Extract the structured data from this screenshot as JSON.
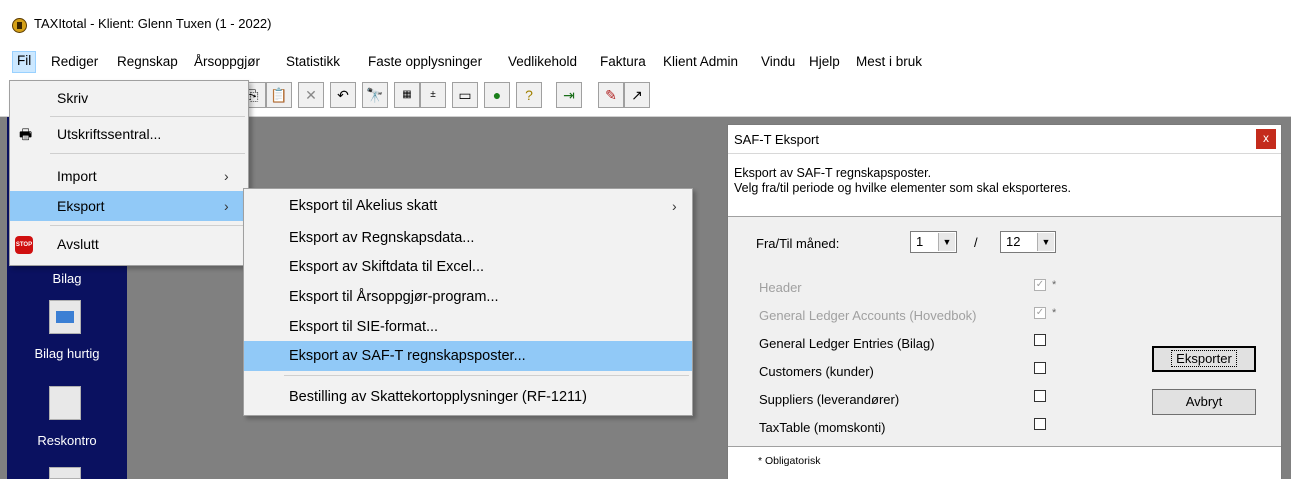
{
  "window": {
    "title": "TAXItotal - Klient: Glenn Tuxen (1 - 2022)"
  },
  "menubar": {
    "items": [
      "Fil",
      "Rediger",
      "Regnskap",
      "Årsoppgjør",
      "Statistikk",
      "Faste opplysninger",
      "Vedlikehold",
      "Faktura",
      "Klient Admin",
      "Vindu",
      "Hjelp",
      "Mest i bruk"
    ]
  },
  "fil_menu": {
    "skriv": "Skriv",
    "utskriftssentral": "Utskriftssentral...",
    "import": "Import",
    "eksport": "Eksport",
    "avslutt": "Avslutt",
    "stop_badge": "STOP"
  },
  "export_menu": {
    "items": [
      "Eksport til Akelius skatt",
      "Eksport av Regnskapsdata...",
      "Eksport av Skiftdata til Excel...",
      "Eksport til Årsoppgjør-program...",
      "Eksport til SIE-format...",
      "Eksport av SAF-T regnskapsposter...",
      "Bestilling av Skattekortopplysninger (RF-1211)"
    ],
    "highlighted_index": 5
  },
  "sidebar": {
    "items": [
      "Bilag",
      "Bilag hurtig",
      "Reskontro"
    ]
  },
  "dialog": {
    "title": "SAF-T Eksport",
    "close": "x",
    "desc_line1": "Eksport av SAF-T regnskapsposter.",
    "desc_line2": "Velg fra/til periode og hvilke elementer som skal eksporteres.",
    "period_label": "Fra/Til måned:",
    "from_month": "1",
    "separator": "/",
    "to_month": "12",
    "elements": [
      {
        "label": "Header",
        "checked": true,
        "disabled": true,
        "required": "*"
      },
      {
        "label": "General Ledger Accounts (Hovedbok)",
        "checked": true,
        "disabled": true,
        "required": "*"
      },
      {
        "label": "General Ledger Entries (Bilag)",
        "checked": false,
        "disabled": false,
        "required": ""
      },
      {
        "label": "Customers (kunder)",
        "checked": false,
        "disabled": false,
        "required": ""
      },
      {
        "label": "Suppliers (leverandører)",
        "checked": false,
        "disabled": false,
        "required": ""
      },
      {
        "label": "TaxTable (momskonti)",
        "checked": false,
        "disabled": false,
        "required": ""
      }
    ],
    "export_button": "Eksporter",
    "cancel_button": "Avbryt",
    "footnote": "* Obligatorisk"
  },
  "colors": {
    "menu_highlight": "#91c9f7",
    "sidebar_bg": "#0a1160",
    "workspace_bg": "#808080",
    "close_button": "#c42b1c"
  }
}
